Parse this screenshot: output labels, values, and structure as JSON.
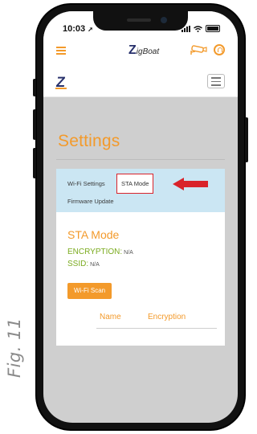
{
  "figure_label": "Fig. 11",
  "status_bar": {
    "time": "10:03",
    "time_arrow": "➚"
  },
  "app_bar": {
    "brand_prefix": "Z",
    "brand_name": "igBoat"
  },
  "page": {
    "title": "Settings"
  },
  "tabs": [
    {
      "label": "Wi-Fi Settings",
      "selected": false
    },
    {
      "label": "STA Mode",
      "selected": true
    },
    {
      "label": "Firmware Update",
      "selected": false
    }
  ],
  "sta_mode": {
    "title": "STA Mode",
    "encryption_label": "ENCRYPTION:",
    "encryption_value": "N/A",
    "ssid_label": "SSID:",
    "ssid_value": "N/A",
    "scan_button": "Wi-Fi Scan",
    "columns": [
      "Name",
      "Encryption"
    ]
  },
  "colors": {
    "accent": "#f39a2b",
    "green": "#7bab1f",
    "tab_bg": "#cbe6f3",
    "highlight": "#d9232a",
    "brand_blue": "#27306b"
  }
}
